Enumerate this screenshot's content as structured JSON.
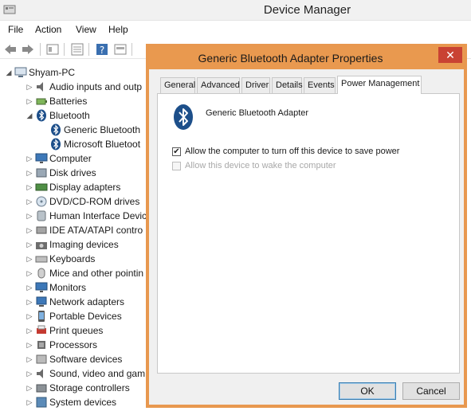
{
  "window": {
    "title": "Device Manager"
  },
  "menubar": [
    "File",
    "Action",
    "View",
    "Help"
  ],
  "tree": {
    "root": {
      "label": "Shyam-PC",
      "icon": "computer-icon"
    },
    "items": [
      {
        "label": "Audio inputs and outp",
        "icon": "speaker-icon",
        "expander": "▷"
      },
      {
        "label": "Batteries",
        "icon": "battery-icon",
        "expander": "▷"
      },
      {
        "label": "Bluetooth",
        "icon": "bluetooth-icon",
        "expander": "◢"
      },
      {
        "label": "Generic Bluetooth",
        "icon": "bluetooth-icon",
        "child": true
      },
      {
        "label": "Microsoft Bluetoot",
        "icon": "bluetooth-icon",
        "child": true
      },
      {
        "label": "Computer",
        "icon": "monitor-icon",
        "expander": "▷"
      },
      {
        "label": "Disk drives",
        "icon": "disk-icon",
        "expander": "▷"
      },
      {
        "label": "Display adapters",
        "icon": "display-adapter-icon",
        "expander": "▷"
      },
      {
        "label": "DVD/CD-ROM drives",
        "icon": "dvd-icon",
        "expander": "▷"
      },
      {
        "label": "Human Interface Devic",
        "icon": "hid-icon",
        "expander": "▷"
      },
      {
        "label": "IDE ATA/ATAPI contro",
        "icon": "ide-icon",
        "expander": "▷"
      },
      {
        "label": "Imaging devices",
        "icon": "camera-icon",
        "expander": "▷"
      },
      {
        "label": "Keyboards",
        "icon": "keyboard-icon",
        "expander": "▷"
      },
      {
        "label": "Mice and other pointin",
        "icon": "mouse-icon",
        "expander": "▷"
      },
      {
        "label": "Monitors",
        "icon": "monitor-icon",
        "expander": "▷"
      },
      {
        "label": "Network adapters",
        "icon": "network-icon",
        "expander": "▷"
      },
      {
        "label": "Portable Devices",
        "icon": "portable-device-icon",
        "expander": "▷"
      },
      {
        "label": "Print queues",
        "icon": "printer-icon",
        "expander": "▷"
      },
      {
        "label": "Processors",
        "icon": "processor-icon",
        "expander": "▷"
      },
      {
        "label": "Software devices",
        "icon": "software-device-icon",
        "expander": "▷"
      },
      {
        "label": "Sound, video and gam",
        "icon": "speaker-icon",
        "expander": "▷"
      },
      {
        "label": "Storage controllers",
        "icon": "storage-icon",
        "expander": "▷"
      },
      {
        "label": "System devices",
        "icon": "system-device-icon",
        "expander": "▷"
      }
    ]
  },
  "dialog": {
    "title": "Generic Bluetooth Adapter Properties",
    "close_glyph": "✕",
    "tabs": [
      "General",
      "Advanced",
      "Driver",
      "Details",
      "Events",
      "Power Management"
    ],
    "active_tab": "Power Management",
    "device_name": "Generic Bluetooth Adapter",
    "options": [
      {
        "label": "Allow the computer to turn off this device to save power",
        "checked": true,
        "enabled": true
      },
      {
        "label": "Allow this device to wake the computer",
        "checked": false,
        "enabled": false
      }
    ],
    "ok_label": "OK",
    "cancel_label": "Cancel"
  },
  "colors": {
    "dialog_frame": "#e8984f",
    "close_button": "#c94233",
    "accent": "#3c7fb1"
  }
}
